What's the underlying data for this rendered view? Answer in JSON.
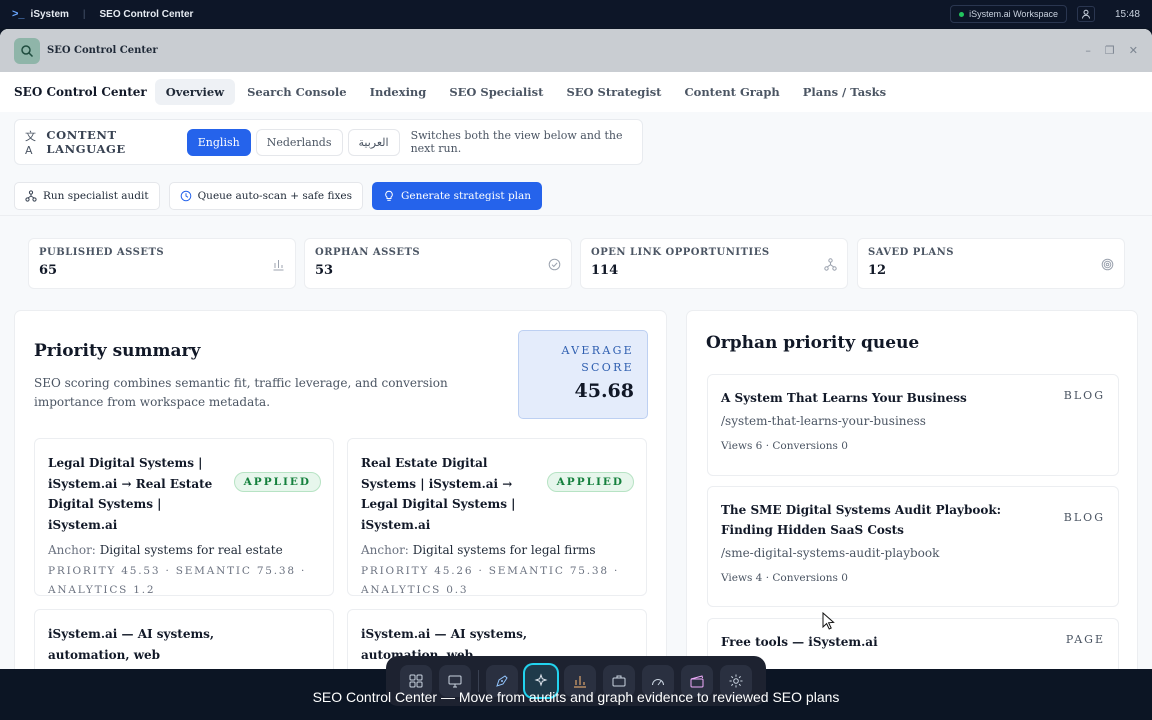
{
  "os": {
    "brand": "iSystem",
    "app_title": "SEO Control Center",
    "workspace": "iSystem.ai Workspace",
    "time": "15:48"
  },
  "window": {
    "title": "SEO Control Center"
  },
  "nav": {
    "title": "SEO Control Center",
    "tabs": [
      "Overview",
      "Search Console",
      "Indexing",
      "SEO Specialist",
      "SEO Strategist",
      "Content Graph",
      "Plans / Tasks"
    ],
    "active_tab": "Overview"
  },
  "language": {
    "label": "CONTENT LANGUAGE",
    "options": [
      "English",
      "Nederlands",
      "العربية"
    ],
    "selected": "English",
    "note": "Switches both the view below and the next run."
  },
  "actions": {
    "run_audit": "Run specialist audit",
    "queue": "Queue auto-scan + safe fixes",
    "generate": "Generate strategist plan"
  },
  "stats": [
    {
      "label": "PUBLISHED ASSETS",
      "value": "65",
      "icon": "bar-chart-icon"
    },
    {
      "label": "ORPHAN ASSETS",
      "value": "53",
      "icon": "check-circle-icon"
    },
    {
      "label": "OPEN LINK OPPORTUNITIES",
      "value": "114",
      "icon": "network-icon"
    },
    {
      "label": "SAVED PLANS",
      "value": "12",
      "icon": "target-icon"
    }
  ],
  "priority": {
    "title": "Priority summary",
    "description": "SEO scoring combines semantic fit, traffic leverage, and conversion importance from workspace metadata.",
    "avg_label_1": "AVERAGE",
    "avg_label_2": "SCORE",
    "avg_value": "45.68",
    "cards": [
      {
        "title": "Legal Digital Systems | iSystem.ai → Real Estate Digital Systems | iSystem.ai",
        "badge": "APPLIED",
        "anchor_key": "Anchor:",
        "anchor_value": "Digital systems for real estate",
        "meta": "PRIORITY 45.53 · SEMANTIC 75.38 · ANALYTICS 1.2"
      },
      {
        "title": "Real Estate Digital Systems | iSystem.ai → Legal Digital Systems | iSystem.ai",
        "badge": "APPLIED",
        "anchor_key": "Anchor:",
        "anchor_value": "Digital systems for legal firms",
        "meta": "PRIORITY 45.26 · SEMANTIC 75.38 · ANALYTICS 0.3"
      },
      {
        "title": "iSystem.ai — AI systems, automation, web development"
      },
      {
        "title": "iSystem.ai — AI systems, automation, web development"
      }
    ]
  },
  "orphans": {
    "title": "Orphan priority queue",
    "items": [
      {
        "title": "A System That Learns Your Business",
        "type": "BLOG",
        "path": "/system-that-learns-your-business",
        "stats": "Views 6 · Conversions 0"
      },
      {
        "title": "The SME Digital Systems Audit Playbook: Finding Hidden SaaS Costs",
        "type": "BLOG",
        "path": "/sme-digital-systems-audit-playbook",
        "stats": "Views 4 · Conversions 0"
      },
      {
        "title": "Free tools — iSystem.ai",
        "type": "PAGE"
      }
    ]
  },
  "dock": {
    "icons": [
      "grid-icon",
      "monitor-icon",
      "pen-icon",
      "sparkle-icon",
      "bar-chart-icon",
      "briefcase-icon",
      "gauge-icon",
      "clapperboard-icon",
      "gear-icon"
    ]
  },
  "caption": "SEO Control Center — Move from audits and graph evidence to reviewed SEO plans"
}
